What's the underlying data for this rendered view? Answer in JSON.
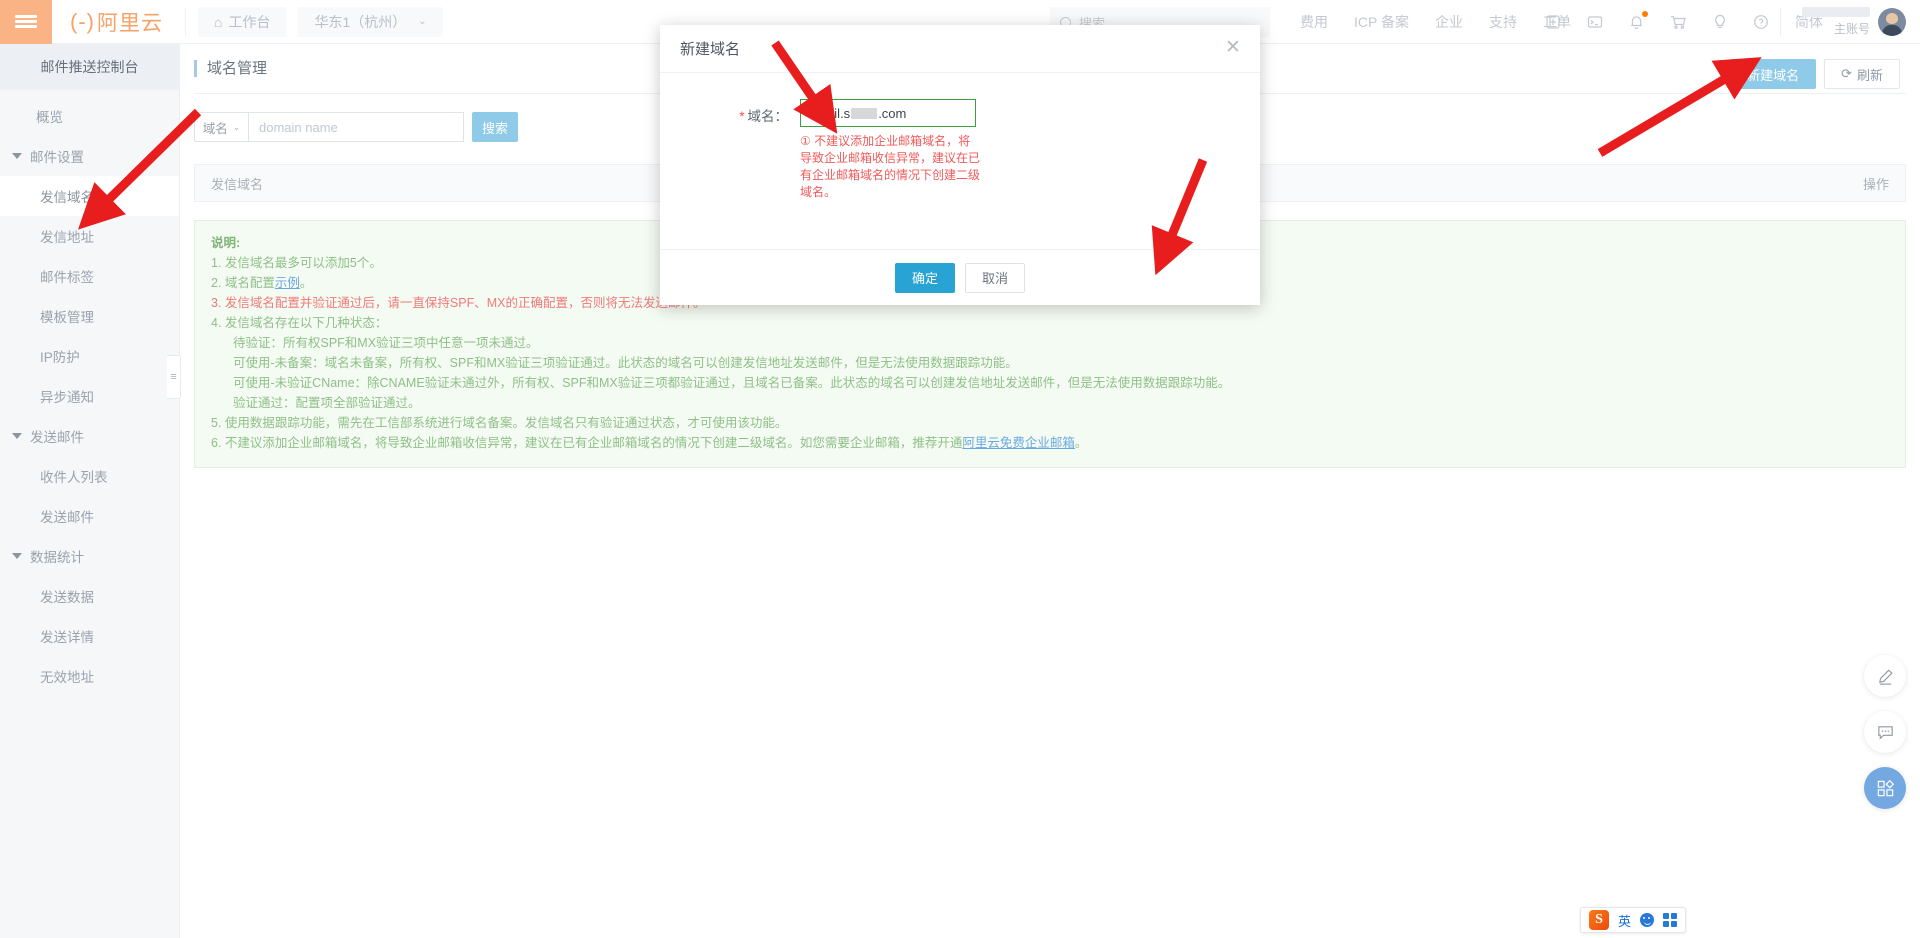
{
  "topbar": {
    "brand": "阿里云",
    "workbench": "工作台",
    "region": "华东1（杭州）",
    "search_placeholder": "搜索...",
    "links": [
      "费用",
      "ICP 备案",
      "企业",
      "支持",
      "工单"
    ],
    "icons": [
      "shell-icon",
      "terminal-icon",
      "bell-icon",
      "cart-icon",
      "bulb-icon",
      "help-icon"
    ],
    "lang": "简体",
    "account_label": "主账号"
  },
  "sidebar": {
    "console_title": "邮件推送控制台",
    "items": [
      {
        "label": "概览",
        "type": "top"
      },
      {
        "label": "邮件设置",
        "type": "group"
      },
      {
        "label": "发信域名",
        "type": "leaf",
        "active": true
      },
      {
        "label": "发信地址",
        "type": "leaf"
      },
      {
        "label": "邮件标签",
        "type": "leaf"
      },
      {
        "label": "模板管理",
        "type": "leaf"
      },
      {
        "label": "IP防护",
        "type": "leaf"
      },
      {
        "label": "异步通知",
        "type": "leaf"
      },
      {
        "label": "发送邮件",
        "type": "group"
      },
      {
        "label": "收件人列表",
        "type": "leaf"
      },
      {
        "label": "发送邮件",
        "type": "leaf"
      },
      {
        "label": "数据统计",
        "type": "group"
      },
      {
        "label": "发送数据",
        "type": "leaf"
      },
      {
        "label": "发送详情",
        "type": "leaf"
      },
      {
        "label": "无效地址",
        "type": "leaf"
      }
    ]
  },
  "page": {
    "title": "域名管理",
    "new_domain_button": "新建域名",
    "refresh_button": "刷新",
    "filter_select": "域名",
    "filter_placeholder": "domain name",
    "search_button": "搜索",
    "table_col_domain": "发信域名",
    "table_col_action": "操作"
  },
  "notice": {
    "heading": "说明:",
    "lines": [
      {
        "text": "1. 发信域名最多可以添加5个。",
        "style": "green"
      },
      {
        "text": "2. 域名配置",
        "link": "示例",
        "tail": "。",
        "style": "green"
      },
      {
        "text": "3. 发信域名配置并验证通过后，请一直保持SPF、MX的正确配置，否则将无法发送邮件。",
        "style": "red"
      },
      {
        "text": "4. 发信域名存在以下几种状态：",
        "style": "green"
      },
      {
        "text": "待验证：所有权SPF和MX验证三项中任意一项未通过。",
        "style": "green",
        "indent": true
      },
      {
        "text": "可使用-未备案：域名未备案，所有权、SPF和MX验证三项验证通过。此状态的域名可以创建发信地址发送邮件，但是无法使用数据跟踪功能。",
        "style": "green",
        "indent": true
      },
      {
        "text": "可使用-未验证CName：除CNAME验证未通过外，所有权、SPF和MX验证三项都验证通过，且域名已备案。此状态的域名可以创建发信地址发送邮件，但是无法使用数据跟踪功能。",
        "style": "green",
        "indent": true
      },
      {
        "text": "验证通过：配置项全部验证通过。",
        "style": "green",
        "indent": true
      },
      {
        "text": "5. 使用数据跟踪功能，需先在工信部系统进行域名备案。发信域名只有验证通过状态，才可使用该功能。",
        "style": "green"
      },
      {
        "text": "6. 不建议添加企业邮箱域名，将导致企业邮箱收信异常，建议在已有企业邮箱域名的情况下创建二级域名。如您需要企业邮箱，推荐开通",
        "link": "阿里云免费企业邮箱",
        "tail": "。",
        "style": "green"
      }
    ]
  },
  "modal": {
    "title": "新建域名",
    "field_label": "域名：",
    "field_value_prefix": "email.s",
    "field_value_suffix": ".com",
    "error_text": "① 不建议添加企业邮箱域名，将导致企业邮箱收信异常，建议在已有企业邮箱域名的情况下创建二级域名。",
    "ok_button": "确定",
    "cancel_button": "取消"
  },
  "rail": {
    "buttons": [
      "pencil-icon",
      "feedback-icon",
      "apps-icon"
    ]
  },
  "ime": {
    "logo": "S",
    "mode": "英"
  },
  "colors": {
    "brand_orange": "#f7a265",
    "primary_blue": "#29a3d4",
    "light_blue": "#8fcbe8",
    "notice_green": "#8fbf88",
    "error_red": "#f05a5a",
    "arrow_red": "#e81e1e"
  }
}
